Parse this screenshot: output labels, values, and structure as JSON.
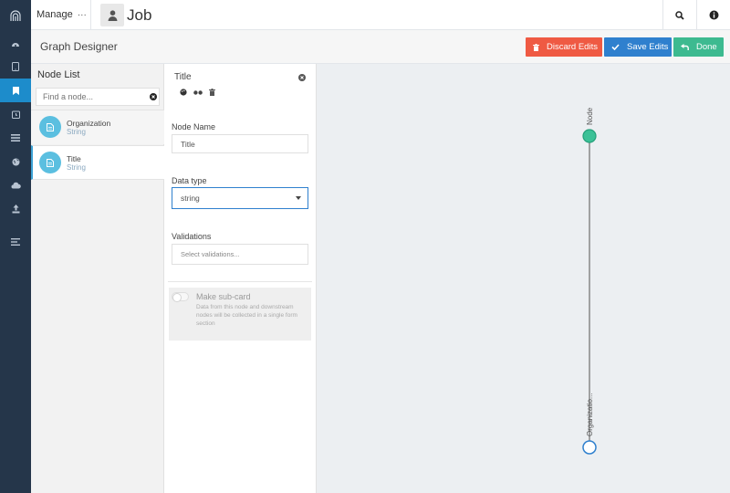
{
  "topbar": {
    "manage_label": "Manage",
    "manage_more": "···",
    "page_title": "Job",
    "icons": [
      "user-icon",
      "search-icon",
      "info-icon"
    ]
  },
  "rail": {
    "logo": "arches-logo-icon",
    "items": [
      {
        "icon": "dashboard-icon",
        "active": false
      },
      {
        "icon": "tablet-icon",
        "active": false
      },
      {
        "icon": "bookmark-icon",
        "active": true
      },
      {
        "icon": "clock-icon",
        "active": false
      },
      {
        "icon": "list-icon",
        "active": false
      },
      {
        "icon": "globe-icon",
        "active": false
      },
      {
        "icon": "cloud-icon",
        "active": false
      },
      {
        "icon": "upload-icon",
        "active": false
      },
      {
        "icon": "lines-icon",
        "active": false
      }
    ]
  },
  "subheader": {
    "title": "Graph Designer",
    "discard_label": "Discard Edits",
    "save_label": "Save Edits",
    "done_label": "Done"
  },
  "node_list": {
    "title": "Node List",
    "search_placeholder": "Find a node...",
    "items": [
      {
        "name": "Organization",
        "type": "String",
        "selected": false
      },
      {
        "name": "Title",
        "type": "String",
        "selected": true
      }
    ]
  },
  "properties": {
    "title": "Title",
    "node_name_label": "Node Name",
    "node_name_value": "Title",
    "data_type_label": "Data type",
    "data_type_value": "string",
    "validations_label": "Validations",
    "validations_placeholder": "Select validations...",
    "subcard_title": "Make sub-card",
    "subcard_desc": "Data from this node and downstream nodes will be collected in a single form section",
    "subcard_enabled": false
  },
  "graph": {
    "top_node_label": "Node",
    "bottom_node_label": "Organizatio...",
    "colors": {
      "root_fill": "#3cc197",
      "leaf_stroke": "#2f80ce",
      "edge": "#777777"
    }
  },
  "colors": {
    "rail_bg": "#25364a",
    "rail_active": "#1d8ccb",
    "discard": "#ef5a43",
    "save": "#2f80ce",
    "done": "#3dba90"
  }
}
